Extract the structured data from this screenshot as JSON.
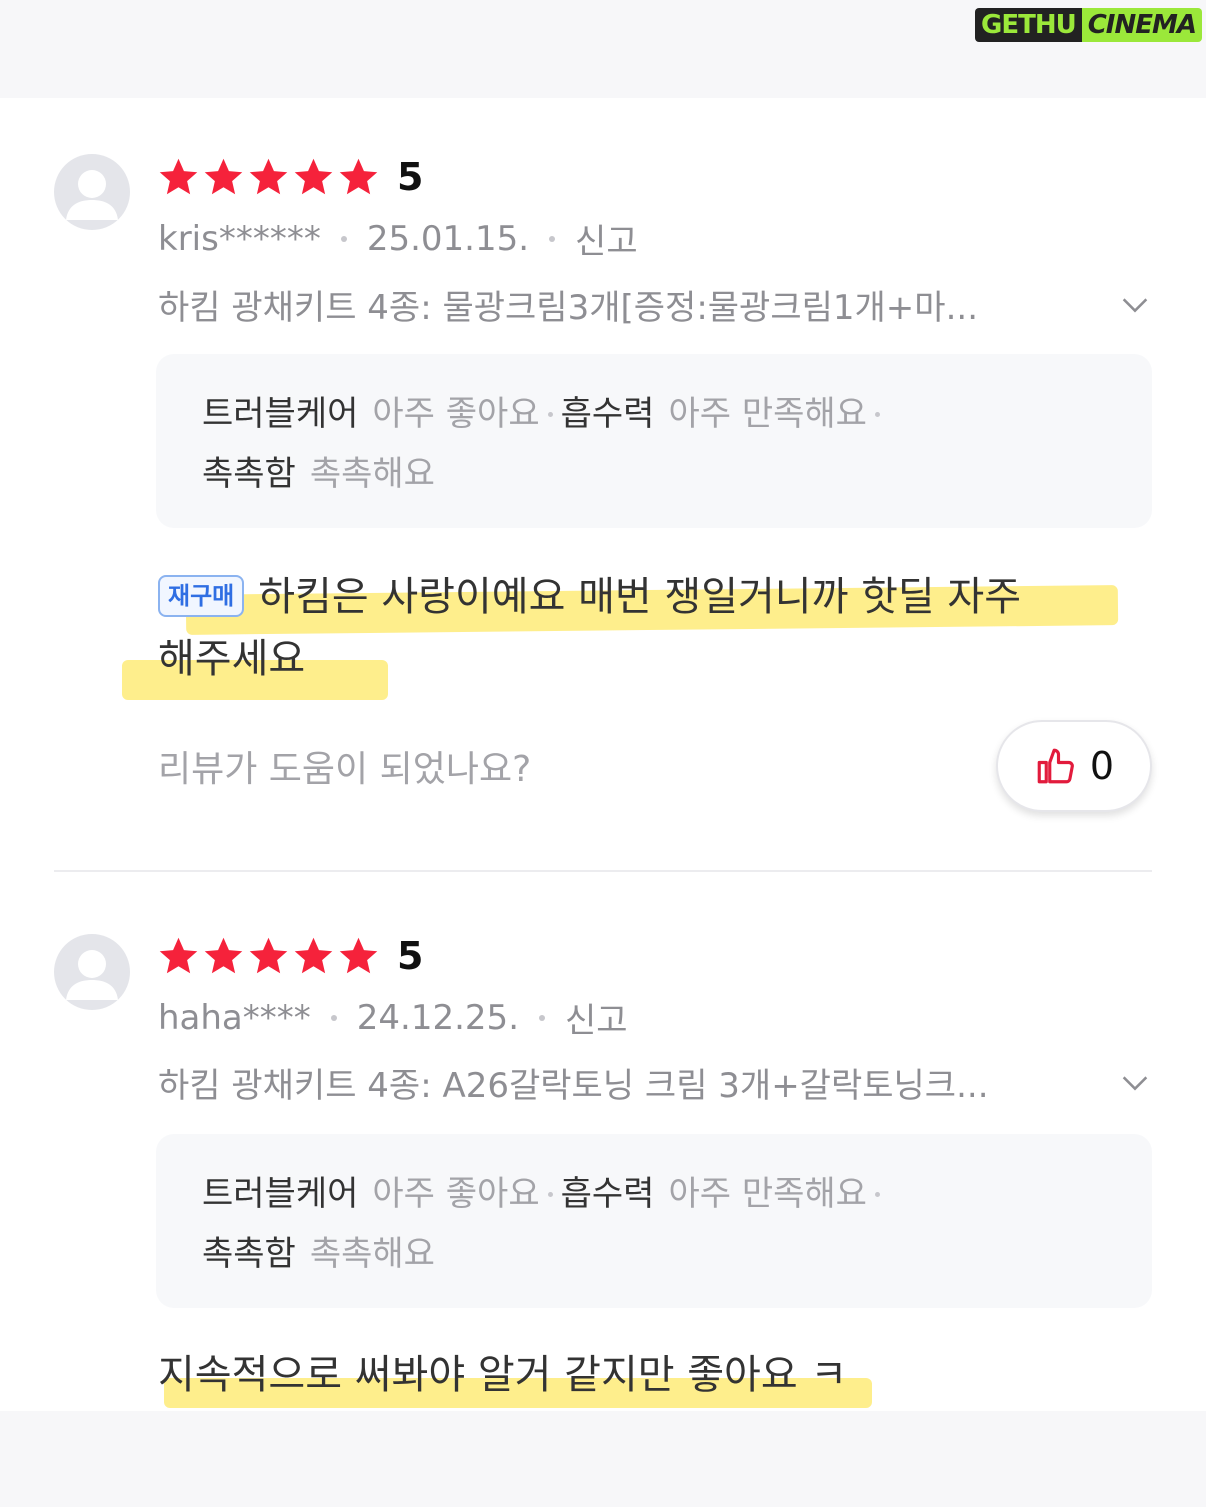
{
  "watermark": {
    "left": "GETHU",
    "right": "CINEMA"
  },
  "colors": {
    "star": "#f5223b",
    "highlight": "#fde866",
    "rebuy": "#2f6ee3"
  },
  "reviews": [
    {
      "score": "5",
      "user": "kris******",
      "date": "25.01.15.",
      "report": "신고",
      "option": "하킴 광채키트 4종: 물광크림3개[증정:물광크림1개+마...",
      "attrs_line1": [
        {
          "key": "트러블케어",
          "val": "아주 좋아요"
        },
        {
          "key": "흡수력",
          "val": "아주 만족해요"
        }
      ],
      "attrs_line2": [
        {
          "key": "촉촉함",
          "val": "촉촉해요"
        }
      ],
      "rebuy_badge": "재구매",
      "body_line1": "하킴은 사랑이예요 매번 쟁일거니까 핫딜 자주",
      "body_line2": "해주세요",
      "helpful_question": "리뷰가 도움이 되었나요?",
      "like_count": "0"
    },
    {
      "score": "5",
      "user": "haha****",
      "date": "24.12.25.",
      "report": "신고",
      "option": "하킴 광채키트 4종: A26갈락토닝 크림 3개+갈락토닝크...",
      "attrs_line1": [
        {
          "key": "트러블케어",
          "val": "아주 좋아요"
        },
        {
          "key": "흡수력",
          "val": "아주 만족해요"
        }
      ],
      "attrs_line2": [
        {
          "key": "촉촉함",
          "val": "촉촉해요"
        }
      ],
      "body_line1": "지속적으로 써봐야 알거 같지만 좋아요 ㅋ"
    }
  ]
}
